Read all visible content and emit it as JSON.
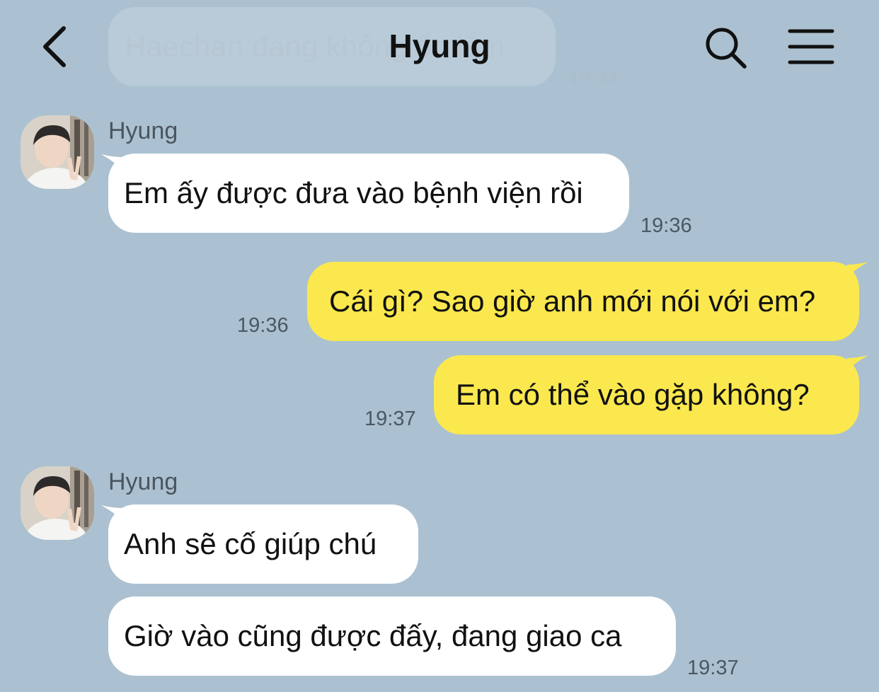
{
  "header": {
    "title": "Hyung",
    "ghost_preview_text": "Haechan đang không ổn lắm",
    "ghost_preview_time": "19:34"
  },
  "colors": {
    "background": "#abc1d1",
    "incoming_bubble": "#ffffff",
    "outgoing_bubble": "#fae84e",
    "timestamp": "#4a5863"
  },
  "icons": {
    "back": "chevron-left-icon",
    "search": "search-icon",
    "menu": "hamburger-menu-icon"
  },
  "messages": [
    {
      "sender": "Hyung",
      "direction": "incoming",
      "text": "Em ấy được đưa vào bệnh viện rồi",
      "time": "19:36"
    },
    {
      "direction": "outgoing",
      "text": "Cái gì? Sao giờ anh mới nói với em?",
      "time": "19:36"
    },
    {
      "direction": "outgoing",
      "text": "Em có thể vào gặp không?",
      "time": "19:37"
    },
    {
      "sender": "Hyung",
      "direction": "incoming",
      "text": "Anh sẽ cố giúp chú"
    },
    {
      "direction": "incoming",
      "text": "Giờ vào cũng được đấy, đang giao ca",
      "time": "19:37"
    }
  ]
}
